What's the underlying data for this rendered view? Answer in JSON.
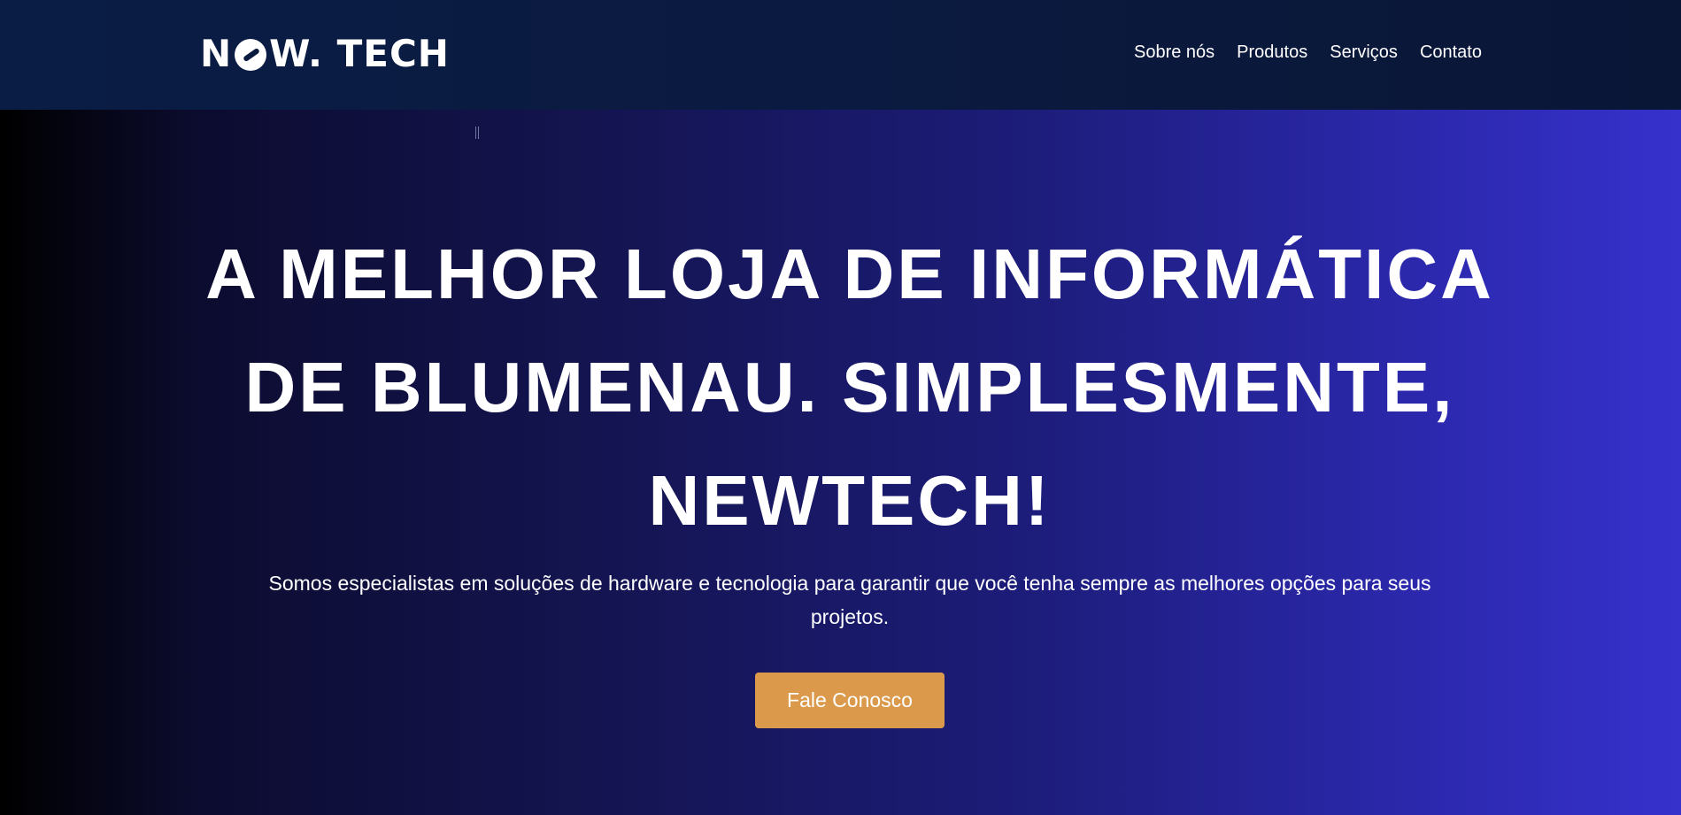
{
  "header": {
    "logo": {
      "part1": "N",
      "part2": "W. TECH"
    },
    "nav": [
      {
        "label": "Sobre nós"
      },
      {
        "label": "Produtos"
      },
      {
        "label": "Serviços"
      },
      {
        "label": "Contato"
      }
    ]
  },
  "hero": {
    "title": "A MELHOR LOJA DE INFORMÁTICA DE BLUMENAU. SIMPLESMENTE, NEWTECH!",
    "subtitle": "Somos especialistas em soluções de hardware e tecnologia para garantir que você tenha sempre as melhores opções para seus projetos.",
    "cta_label": "Fale Conosco"
  },
  "colors": {
    "header_bg": "#0b1a40",
    "hero_gradient_start": "#000000",
    "hero_gradient_end": "#3631cc",
    "cta_bg": "#db9a4b",
    "text": "#ffffff"
  },
  "icons": {
    "logo": "newtech-logo-e-icon"
  }
}
